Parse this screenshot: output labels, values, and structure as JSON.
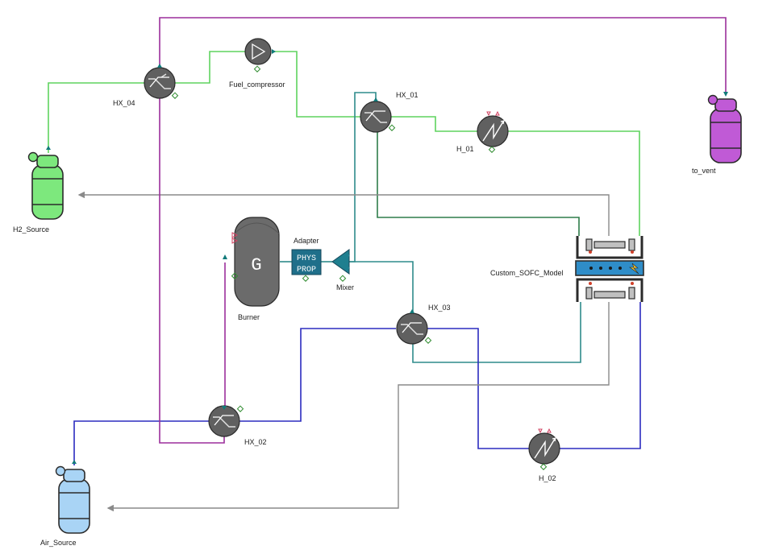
{
  "labels": {
    "hx04": "HX_04",
    "fuel_compressor": "Fuel_compressor",
    "hx01": "HX_01",
    "h01": "H_01",
    "to_vent": "to_vent",
    "h2_source": "H2_Source",
    "adapter": "Adapter",
    "mixer": "Mixer",
    "burner": "Burner",
    "sofc": "Custom_SOFC_Model",
    "hx03": "HX_03",
    "hx02": "HX_02",
    "h02": "H_02",
    "air_source": "Air_Source"
  },
  "burner_text": "G",
  "adapter_text": {
    "line1": "PHYS",
    "line2": "PROP"
  },
  "colors": {
    "fuel": "#5fd35f",
    "anode_exhaust": "#2e8b8b",
    "air": "#2b2bbf",
    "cathode_exhaust": "#8a8a8a",
    "flue": "#9b2f9b",
    "h2_tank": "#7de87d",
    "air_tank": "#a9d4f5",
    "vent_tank": "#c05ad6",
    "unit": "#606060",
    "port": "#117a7a",
    "sofc_band": "#2f8dc8"
  }
}
